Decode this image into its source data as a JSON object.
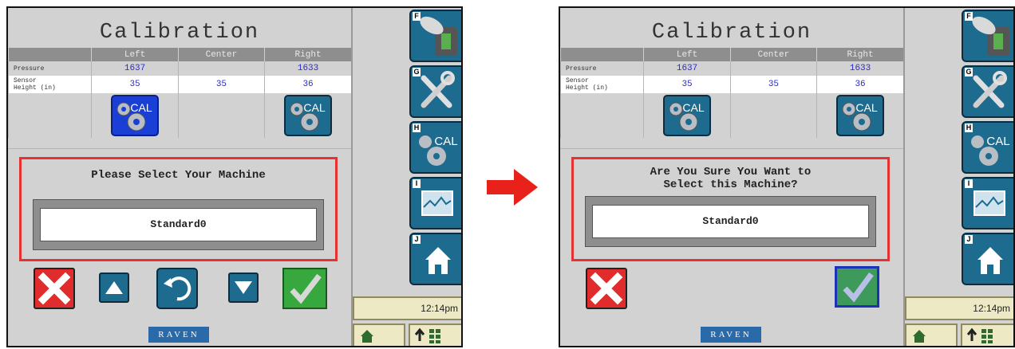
{
  "screens": [
    {
      "title": "Calibration",
      "table": {
        "headers": [
          "",
          "Left",
          "Center",
          "Right"
        ],
        "pressure": {
          "label": "Pressure",
          "left": "1637",
          "center": "",
          "right": "1633"
        },
        "sensor": {
          "label_line1": "Sensor",
          "label_line2": "Height (in)",
          "left": "35",
          "center": "35",
          "right": "36"
        },
        "cal_left": {
          "icon": "cal-gear-icon",
          "label": "CAL",
          "state": "selected"
        },
        "cal_right": {
          "icon": "cal-gear-icon",
          "label": "CAL",
          "state": "normal"
        }
      },
      "prompt": "Please Select Your Machine",
      "machine_value": "Standard0",
      "buttons": [
        "cancel",
        "up",
        "undo",
        "down",
        "accept"
      ],
      "clock": "12:14pm",
      "logo": "RAVEN",
      "side_letters": [
        "F",
        "G",
        "H",
        "I",
        "J"
      ]
    },
    {
      "title": "Calibration",
      "table": {
        "headers": [
          "",
          "Left",
          "Center",
          "Right"
        ],
        "pressure": {
          "label": "Pressure",
          "left": "1637",
          "center": "",
          "right": "1633"
        },
        "sensor": {
          "label_line1": "Sensor",
          "label_line2": "Height (in)",
          "left": "35",
          "center": "35",
          "right": "36"
        },
        "cal_left": {
          "icon": "cal-gear-icon",
          "label": "CAL",
          "state": "normal"
        },
        "cal_right": {
          "icon": "cal-gear-icon",
          "label": "CAL",
          "state": "normal"
        }
      },
      "prompt": "Are You Sure You Want to\nSelect this Machine?",
      "machine_value": "Standard0",
      "buttons": [
        "cancel",
        "accept"
      ],
      "clock": "12:14pm",
      "logo": "RAVEN",
      "side_letters": [
        "F",
        "G",
        "H",
        "I",
        "J"
      ]
    }
  ],
  "colors": {
    "highlight_frame": "#e53232",
    "arrow": "#e8221b",
    "button_blue": "#1d6b8f",
    "cancel_red": "#e02c2c",
    "accept_green": "#37a83e"
  }
}
